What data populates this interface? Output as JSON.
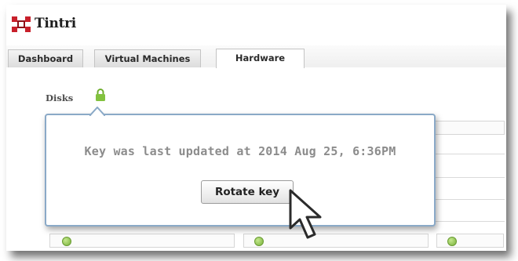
{
  "app": {
    "title": "Tintri"
  },
  "tabs": [
    {
      "label": "Dashboard",
      "active": false
    },
    {
      "label": "Virtual Machines",
      "active": false
    },
    {
      "label": "Hardware",
      "active": true
    }
  ],
  "hardware": {
    "section_label": "Disks"
  },
  "popover": {
    "message": "Key was last updated at 2014 Aug 25, 6:36PM",
    "button_label": "Rotate key"
  },
  "colors": {
    "accent_green": "#78b13a",
    "popover_border": "#8aa9c7",
    "logo_red": "#c8202b"
  }
}
